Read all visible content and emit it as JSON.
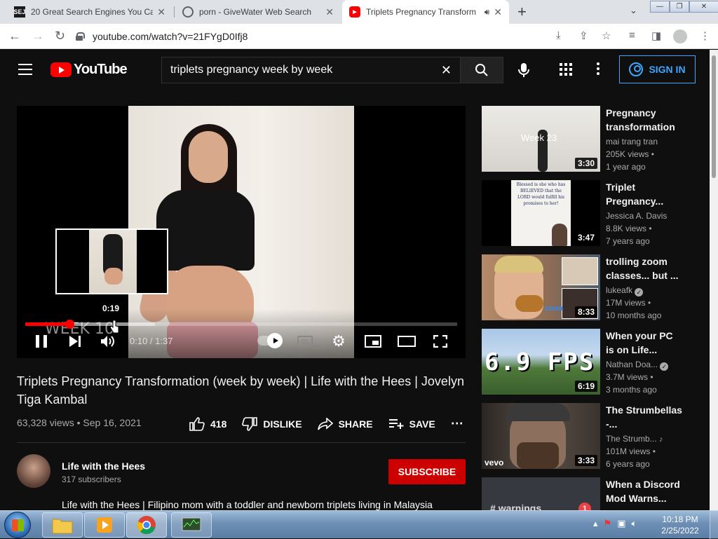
{
  "browser": {
    "tabs": [
      {
        "title": "20 Great Search Engines You Can",
        "favicon": "SEJ"
      },
      {
        "title": "porn - GiveWater Web Search",
        "favicon": "globe"
      },
      {
        "title": "Triplets Pregnancy Transform",
        "favicon": "youtube"
      }
    ],
    "url": "youtube.com/watch?v=21FYgD0Ifj8"
  },
  "youtube": {
    "logo": "YouTube",
    "search_value": "triplets pregnancy week by week",
    "signin": "SIGN IN"
  },
  "player": {
    "overlay_text": "WEEK 10",
    "preview_time": "0:19",
    "time": "0:10 / 1:37",
    "played_fraction": 0.103,
    "buffered_fraction": 0.3
  },
  "video": {
    "title": "Triplets Pregnancy Transformation (week by week) | Life with the Hees | Jovelyn Tiga Kambal",
    "views_date": "63,328 views • Sep 16, 2021",
    "likes": "418",
    "dislike": "DISLIKE",
    "share": "SHARE",
    "save": "SAVE"
  },
  "channel": {
    "name": "Life with the Hees",
    "subscribers": "317 subscribers",
    "subscribe": "SUBSCRIBE",
    "description": "Life with the Hees | Filipino mom with a toddler and newborn triplets living in Malaysia"
  },
  "recommendations": [
    {
      "title": "Pregnancy transformation",
      "channel": "mai trang tran",
      "views": "205K views •",
      "age": "1 year ago",
      "duration": "3:30",
      "thumb_text": "Week 23"
    },
    {
      "title": "Triplet Pregnancy...",
      "channel": "Jessica A. Davis",
      "views": "8.8K views •",
      "age": "7 years ago",
      "duration": "3:47",
      "thumb_text": "Blessed is she who has BELIEVED that the LORD would fulfill his promises to her!"
    },
    {
      "title": "trolling zoom classes... but ...",
      "channel": "lukeafk",
      "views": "17M views •",
      "age": "10 months ago",
      "duration": "8:33",
      "thumb_text": "zoom"
    },
    {
      "title": "When your PC is on Life...",
      "channel": "Nathan Doa...",
      "views": "3.7M views •",
      "age": "3 months ago",
      "duration": "6:19",
      "thumb_text": "6.9 FPS"
    },
    {
      "title": "The Strumbellas -...",
      "channel": "The Strumb...",
      "views": "101M views •",
      "age": "6 years ago",
      "duration": "3:33",
      "thumb_text": "vevo"
    },
    {
      "title": "When a Discord Mod Warns...",
      "channel": "",
      "views": "",
      "age": "",
      "duration": "",
      "thumb_text": "warnings",
      "badge": "1"
    }
  ],
  "taskbar": {
    "time": "10:18 PM",
    "date": "2/25/2022"
  }
}
